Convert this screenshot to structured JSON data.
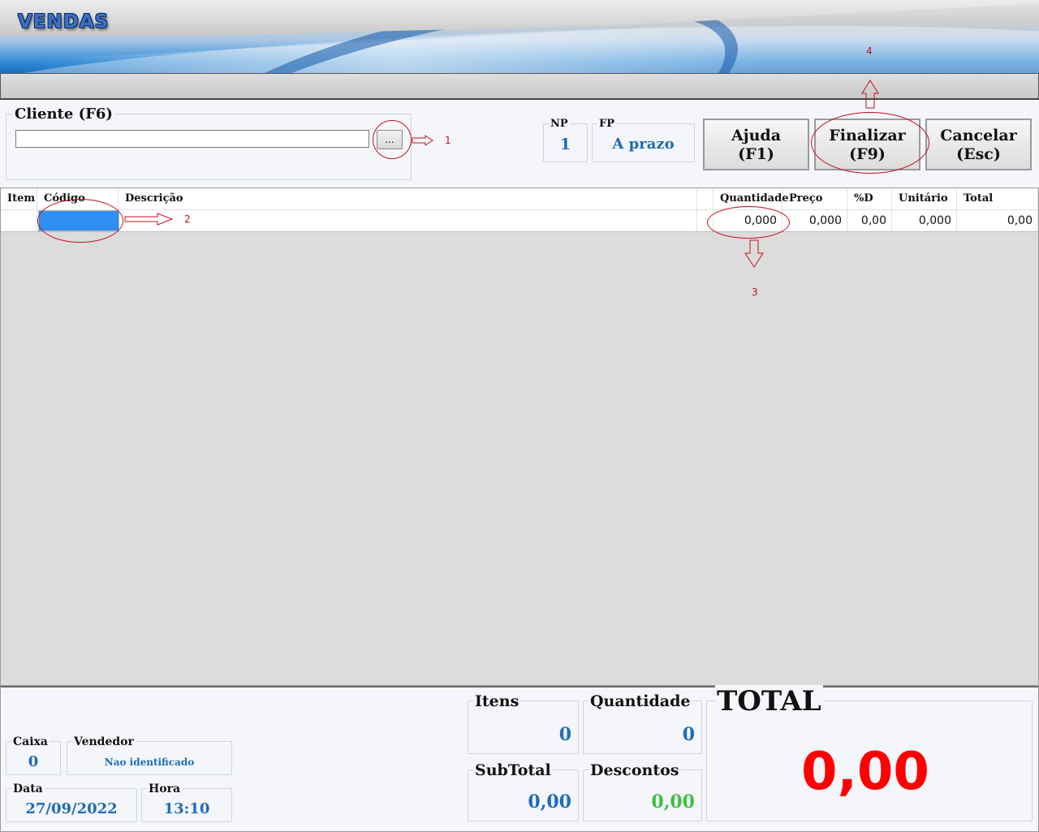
{
  "app": {
    "title": "VENDAS"
  },
  "cliente": {
    "label": "Cliente (F6)",
    "value": "",
    "lookup_label": "..."
  },
  "np": {
    "label": "NP",
    "value": "1"
  },
  "fp": {
    "label": "FP",
    "value": "A prazo"
  },
  "buttons": {
    "ajuda": {
      "line1": "Ajuda",
      "line2": "(F1)"
    },
    "finalizar": {
      "line1": "Finalizar",
      "line2": "(F9)"
    },
    "cancelar": {
      "line1": "Cancelar",
      "line2": "(Esc)"
    }
  },
  "grid": {
    "columns": [
      "Item",
      "Código",
      "Descrição",
      "",
      "Quantidade",
      "Preço",
      "%D",
      "Unitário",
      "Total"
    ],
    "row": {
      "item": "",
      "codigo": "",
      "descricao": "",
      "quantidade": "0,000",
      "preco": "0,000",
      "desconto": "0,00",
      "unitario": "0,000",
      "total": "0,00"
    }
  },
  "annotations": {
    "n1": "1",
    "n2": "2",
    "n3": "3",
    "n4": "4",
    "color": "#c1121f"
  },
  "footer": {
    "caixa": {
      "label": "Caixa",
      "value": "0"
    },
    "vendedor": {
      "label": "Vendedor",
      "value": "Nao identificado"
    },
    "data": {
      "label": "Data",
      "value": "27/09/2022"
    },
    "hora": {
      "label": "Hora",
      "value": "13:10"
    },
    "itens": {
      "label": "Itens",
      "value": "0"
    },
    "quantidade": {
      "label": "Quantidade",
      "value": "0"
    },
    "subtotal": {
      "label": "SubTotal",
      "value": "0,00"
    },
    "descontos": {
      "label": "Descontos",
      "value": "0,00",
      "color": "#3fbf3f"
    },
    "total": {
      "label": "TOTAL",
      "value": "0,00",
      "color": "#ff0000"
    }
  },
  "colors": {
    "value_blue": "#1f6cb5",
    "selected_cell": "#2e8ff0"
  }
}
